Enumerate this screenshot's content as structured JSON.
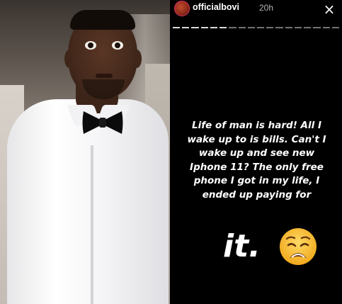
{
  "story": {
    "username": "officialbovi",
    "timestamp": "20h",
    "close_symbol": "×",
    "text": "Life of man is hard! All I wake up to is bills. Can't I wake up and see new Iphone 11? The only free phone I got in my life, I ended up paying for",
    "big_word": "it.",
    "emoji": "weary-face-icon"
  },
  "photo": {
    "subject": "man-in-white-shirt-bowtie"
  },
  "colors": {
    "story_bg": "#000000",
    "text": "#ffffff",
    "avatar_ring": "#e1306c",
    "emoji_face": "#f7c13a"
  }
}
